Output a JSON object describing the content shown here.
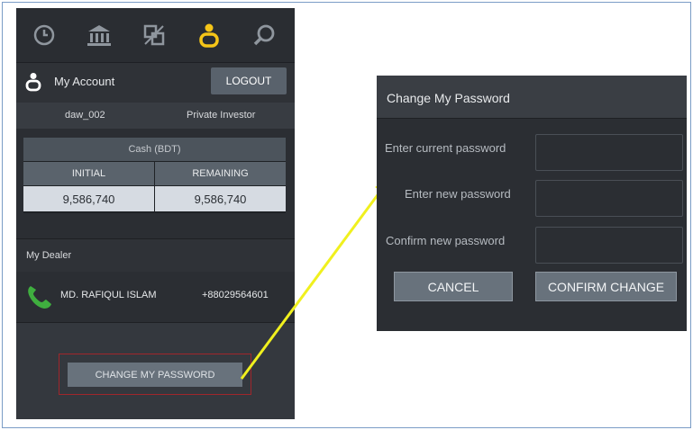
{
  "nav": {
    "tabs": [
      {
        "icon": "clock-icon"
      },
      {
        "icon": "bank-icon"
      },
      {
        "icon": "trade-icon"
      },
      {
        "icon": "account-icon",
        "active": true
      },
      {
        "icon": "search-icon"
      }
    ]
  },
  "account": {
    "label": "My Account",
    "logout_label": "LOGOUT",
    "user_id": "daw_002",
    "user_type": "Private Investor"
  },
  "cash": {
    "title": "Cash (BDT)",
    "col_initial": "INITIAL",
    "col_remaining": "REMAINING",
    "initial_value": "9,586,740",
    "remaining_value": "9,586,740"
  },
  "dealer": {
    "section_label": "My Dealer",
    "name": "MD. RAFIQUL ISLAM",
    "phone": "+88029564601"
  },
  "change_password_button": "CHANGE MY PASSWORD",
  "dialog": {
    "title": "Change My Password",
    "current_label": "Enter current password",
    "new_label": "Enter new password",
    "confirm_label": "Confirm new password",
    "cancel_label": "CANCEL",
    "confirm_button": "CONFIRM CHANGE"
  },
  "colors": {
    "accent": "#f5c518",
    "phone_icon": "#3fae3f",
    "arrow": "#f0f01e"
  }
}
